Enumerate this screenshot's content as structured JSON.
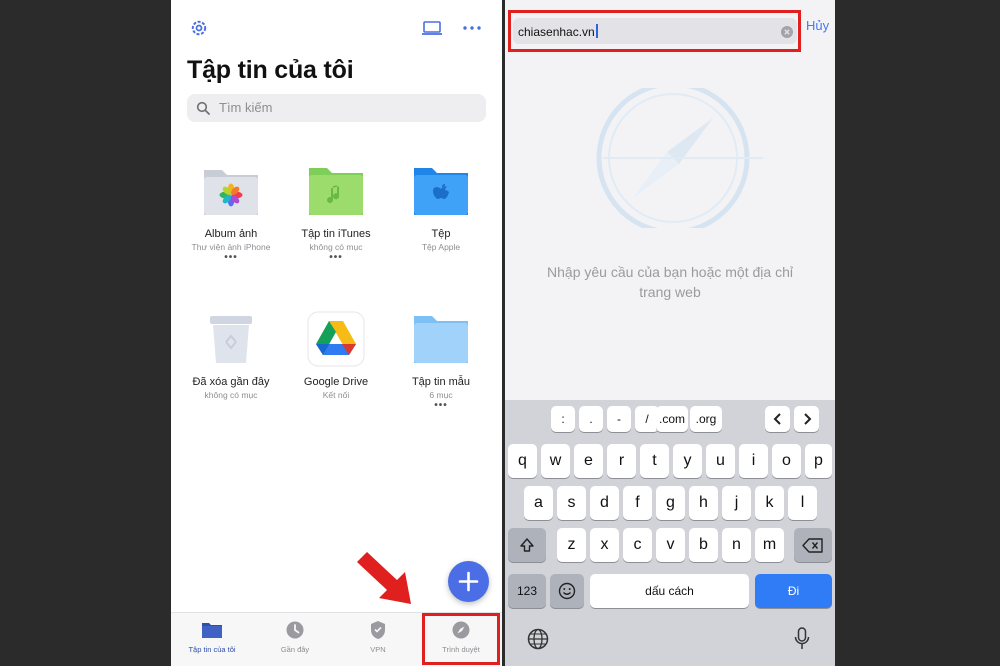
{
  "left_screen": {
    "title": "Tập tin của tôi",
    "search_placeholder": "Tìm kiếm",
    "items": [
      {
        "name": "Album ảnh",
        "sub": "Thư viện ảnh iPhone",
        "icon": "photos-folder-icon"
      },
      {
        "name": "Tập tin iTunes",
        "sub": "không có mục",
        "icon": "itunes-folder-icon"
      },
      {
        "name": "Tệp",
        "sub": "Tệp Apple",
        "icon": "apple-files-folder-icon"
      },
      {
        "name": "Đã xóa gần đây",
        "sub": "không có mục",
        "icon": "trash-bin-icon"
      },
      {
        "name": "Google Drive",
        "sub": "Kết nối",
        "icon": "google-drive-icon"
      },
      {
        "name": "Tập tin mẫu",
        "sub": "6 mục",
        "icon": "sample-folder-icon"
      }
    ],
    "item_dots": "•••",
    "tabs": [
      {
        "label": "Tập tin của tôi",
        "icon": "folder-icon"
      },
      {
        "label": "Gần đây",
        "icon": "clock-icon"
      },
      {
        "label": "VPN",
        "icon": "shield-icon"
      },
      {
        "label": "Trình duyệt",
        "icon": "compass-icon"
      }
    ],
    "colors": {
      "accent": "#4b6ee6",
      "highlight": "#e0201f"
    }
  },
  "right_screen": {
    "url_value": "chiasenhac.vn",
    "cancel_label": "Hủy",
    "hint_line1": "Nhập yêu cầu của bạn hoặc một địa chỉ",
    "hint_line2": "trang web",
    "keyboard": {
      "special_row": [
        ":",
        ".",
        "-",
        "/",
        ".com",
        ".org"
      ],
      "row1": [
        "q",
        "w",
        "e",
        "r",
        "t",
        "y",
        "u",
        "i",
        "o",
        "p"
      ],
      "row2": [
        "a",
        "s",
        "d",
        "f",
        "g",
        "h",
        "j",
        "k",
        "l"
      ],
      "row3": [
        "z",
        "x",
        "c",
        "v",
        "b",
        "n",
        "m"
      ],
      "numbers_label": "123",
      "space_label": "dấu cách",
      "go_label": "Đi"
    }
  }
}
